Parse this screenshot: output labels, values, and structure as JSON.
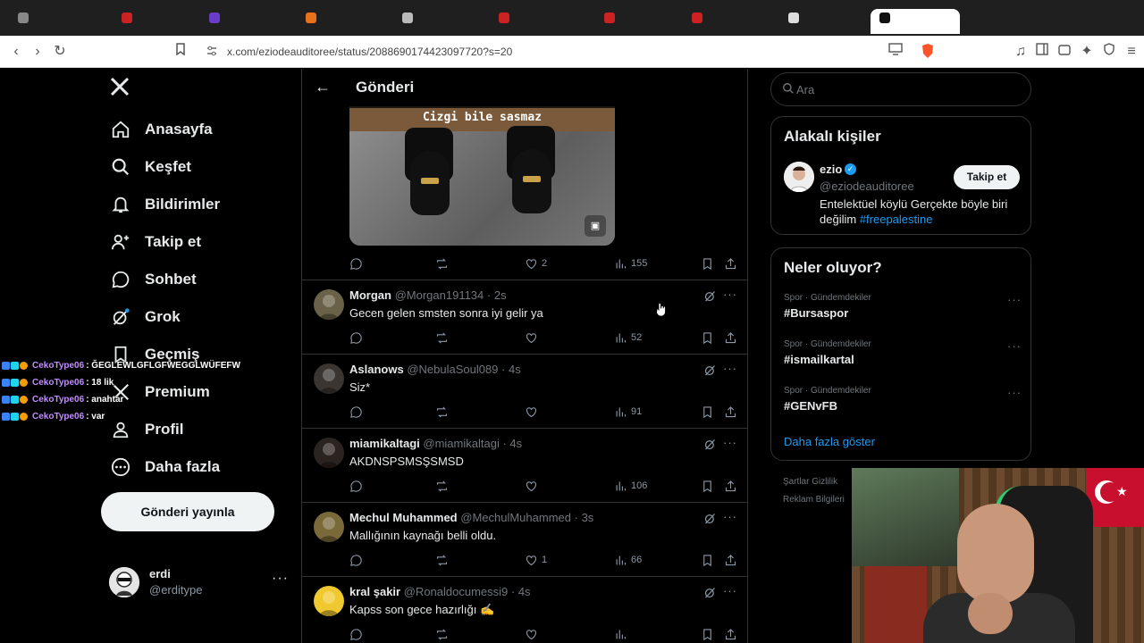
{
  "browser": {
    "url": "x.com/eziodeauditoree/status/2088690174423097720?s=20"
  },
  "sidebar": {
    "logo_icon": "x-logo-icon",
    "items": [
      {
        "label": "Anasayfa",
        "icon": "home-icon"
      },
      {
        "label": "Keşfet",
        "icon": "search-icon"
      },
      {
        "label": "Bildirimler",
        "icon": "bell-icon"
      },
      {
        "label": "Takip et",
        "icon": "person-add-icon"
      },
      {
        "label": "Sohbet",
        "icon": "chat-icon"
      },
      {
        "label": "Grok",
        "icon": "grok-icon"
      },
      {
        "label": "Geçmiş",
        "icon": "bookmark-icon"
      },
      {
        "label": "Premium",
        "icon": "premium-icon"
      },
      {
        "label": "Profil",
        "icon": "profile-icon"
      },
      {
        "label": "Daha fazla",
        "icon": "more-circle-icon"
      }
    ],
    "post_button": "Gönderi yayınla",
    "account": {
      "name": "erdi",
      "handle": "@erditype",
      "more": "···"
    }
  },
  "main": {
    "header_title": "Gönderi",
    "media_caption": "Cizgi bile sasmaz",
    "post_actions": {
      "likes": "2",
      "views": "155"
    },
    "replies": [
      {
        "name": "Morgan",
        "handle": "@Morgan191134",
        "time": "· 2s",
        "text": "Gecen gelen smsten sonra iyi gelir ya",
        "likes": "",
        "views": "52",
        "avatar_color": "#6a6248"
      },
      {
        "name": "Aslanows",
        "handle": "@NebulaSoul089",
        "time": "· 4s",
        "text": "Siz*",
        "likes": "",
        "views": "91",
        "avatar_color": "#3a3530"
      },
      {
        "name": "miamikaltagi",
        "handle": "@miamikaltagi",
        "time": "· 4s",
        "text": "AKDNSPSMSŞSMSD",
        "likes": "",
        "views": "106",
        "avatar_color": "#2a2320"
      },
      {
        "name": "Mechul Muhammed",
        "handle": "@MechulMuhammed",
        "time": "· 3s",
        "text": "Mallığının kaynağı belli oldu.",
        "likes": "1",
        "views": "66",
        "avatar_color": "#7a6a3a"
      },
      {
        "name": "kral şakir",
        "handle": "@Ronaldocumessi9",
        "time": "· 4s",
        "text": "Kapss son gece hazırlığı ✍️",
        "likes": "",
        "views": "",
        "avatar_color": "#f0c830"
      }
    ]
  },
  "right": {
    "search_placeholder": "Ara",
    "related": {
      "title": "Alakalı kişiler",
      "name": "ezio",
      "handle": "@eziodeauditoree",
      "follow": "Takip et",
      "bio": "Entelektüel köylü Gerçekte böyle biri değilim",
      "bio_tag": "#freepalestine"
    },
    "trends": {
      "title": "Neler oluyor?",
      "items": [
        {
          "meta": "Spor · Gündemdekiler",
          "name": "#Bursaspor"
        },
        {
          "meta": "Spor · Gündemdekiler",
          "name": "#ismailkartal"
        },
        {
          "meta": "Spor · Gündemdekiler",
          "name": "#GENvFB"
        }
      ],
      "show_more": "Daha fazla göster"
    },
    "footer": {
      "line1": "Şartlar  Gizlilik",
      "line2": "Reklam Bilgileri"
    }
  },
  "chat": [
    {
      "user": "CekoType06",
      "msg": ": ĞEGLEWLGFLGFWEGGLWÜFEFW"
    },
    {
      "user": "CekoType06",
      "msg": ": 18 lik"
    },
    {
      "user": "CekoType06",
      "msg": ": anahtar"
    },
    {
      "user": "CekoType06",
      "msg": ": var"
    }
  ],
  "colors": {
    "accent": "#1d9bf0",
    "chat_user": "#c28dff",
    "background": "#000000"
  }
}
